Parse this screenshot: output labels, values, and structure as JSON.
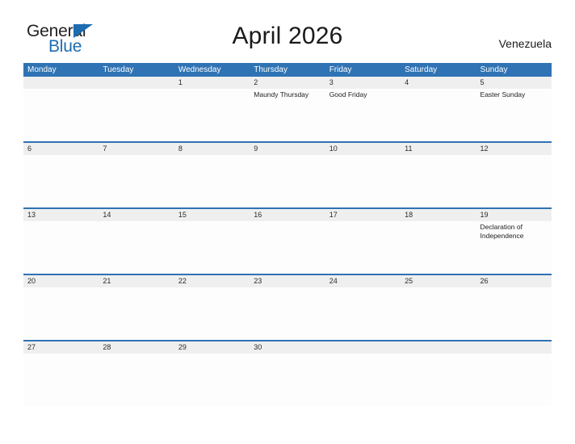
{
  "brand": {
    "name_part1": "General",
    "name_part2": "Blue",
    "triangle_icon": "blue-triangle-icon",
    "accent_color": "#1c6cb0"
  },
  "header": {
    "title": "April 2026",
    "country": "Venezuela"
  },
  "theme": {
    "header_blue": "#2f73b4",
    "date_band_gray": "#efefef",
    "body_white": "#fdfdfd",
    "text_dark": "#222222"
  },
  "calendar": {
    "weekdays": [
      "Monday",
      "Tuesday",
      "Wednesday",
      "Thursday",
      "Friday",
      "Saturday",
      "Sunday"
    ],
    "weeks": [
      {
        "days": [
          {
            "date": "",
            "events": []
          },
          {
            "date": "",
            "events": []
          },
          {
            "date": "1",
            "events": []
          },
          {
            "date": "2",
            "events": [
              "Maundy Thursday"
            ]
          },
          {
            "date": "3",
            "events": [
              "Good Friday"
            ]
          },
          {
            "date": "4",
            "events": []
          },
          {
            "date": "5",
            "events": [
              "Easter Sunday"
            ]
          }
        ]
      },
      {
        "days": [
          {
            "date": "6",
            "events": []
          },
          {
            "date": "7",
            "events": []
          },
          {
            "date": "8",
            "events": []
          },
          {
            "date": "9",
            "events": []
          },
          {
            "date": "10",
            "events": []
          },
          {
            "date": "11",
            "events": []
          },
          {
            "date": "12",
            "events": []
          }
        ]
      },
      {
        "days": [
          {
            "date": "13",
            "events": []
          },
          {
            "date": "14",
            "events": []
          },
          {
            "date": "15",
            "events": []
          },
          {
            "date": "16",
            "events": []
          },
          {
            "date": "17",
            "events": []
          },
          {
            "date": "18",
            "events": []
          },
          {
            "date": "19",
            "events": [
              "Declaration of Independence"
            ]
          }
        ]
      },
      {
        "days": [
          {
            "date": "20",
            "events": []
          },
          {
            "date": "21",
            "events": []
          },
          {
            "date": "22",
            "events": []
          },
          {
            "date": "23",
            "events": []
          },
          {
            "date": "24",
            "events": []
          },
          {
            "date": "25",
            "events": []
          },
          {
            "date": "26",
            "events": []
          }
        ]
      },
      {
        "days": [
          {
            "date": "27",
            "events": []
          },
          {
            "date": "28",
            "events": []
          },
          {
            "date": "29",
            "events": []
          },
          {
            "date": "30",
            "events": []
          },
          {
            "date": "",
            "events": []
          },
          {
            "date": "",
            "events": []
          },
          {
            "date": "",
            "events": []
          }
        ]
      }
    ]
  }
}
